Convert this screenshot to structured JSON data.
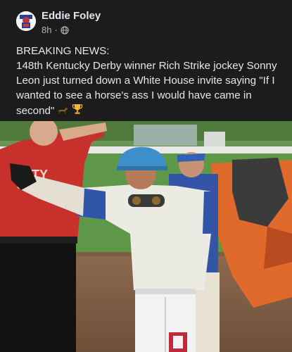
{
  "post": {
    "author": "Eddie Foley",
    "time": "8h",
    "separator": "·",
    "privacy_icon": "globe-icon",
    "text_line1": "BREAKING NEWS:",
    "text_body": "148th Kentucky Derby winner Rich Strike jockey Sonny Leon just turned down a White House invite saying \"If I wanted to see a horse's ass I would have came in second\"",
    "emojis": [
      "horse-icon",
      "trophy-icon"
    ]
  },
  "photo": {
    "shirt_text": "ITY"
  },
  "colors": {
    "background": "#1c1c1d",
    "text": "#e4e6eb",
    "secondary_text": "#b0b3b8"
  }
}
